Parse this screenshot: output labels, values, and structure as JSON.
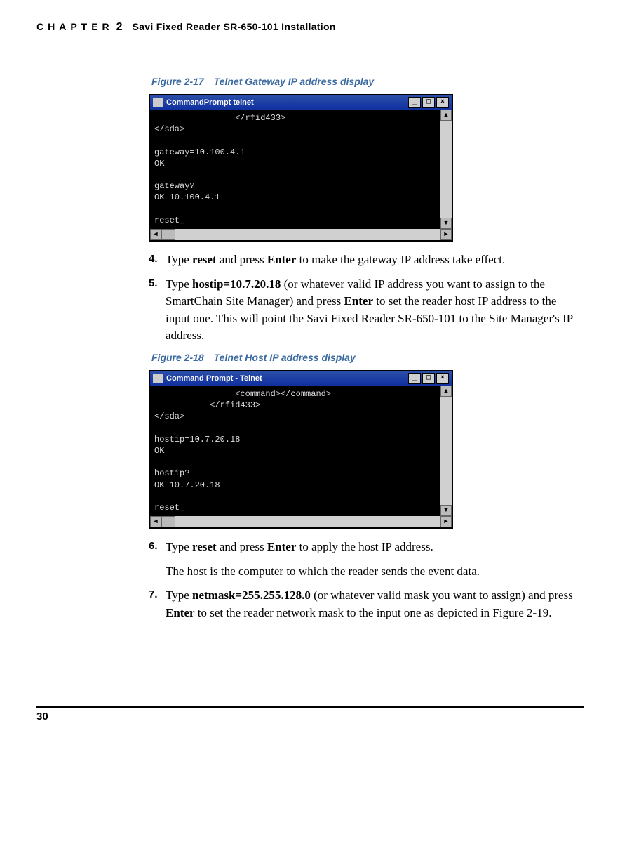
{
  "header": {
    "chapter_word": "CHAPTER",
    "chapter_num": "2",
    "title": "Savi Fixed Reader SR-650-101 Installation"
  },
  "fig17": {
    "label": "Figure 2-17",
    "caption": "Telnet Gateway IP address display",
    "titlebar_text": "CommandPrompt telnet",
    "body": "                </rfid433>\n</sda>\n\ngateway=10.100.4.1\nOK\n\ngateway?\nOK 10.100.4.1\n\nreset_"
  },
  "step4": {
    "num": "4.",
    "pre": "Type ",
    "cmd": "reset",
    "mid": " and press ",
    "key": "Enter",
    "post": " to make the gateway IP address take effect."
  },
  "step5": {
    "num": "5.",
    "pre": "Type ",
    "cmd": "hostip=10.7.20.18",
    "mid": " (or whatever valid IP address you want to assign to the SmartChain Site Manager) and press ",
    "key": "Enter",
    "post": " to set the reader host IP address to the input one. This will point the Savi Fixed Reader SR-650-101 to the Site Manager's IP address."
  },
  "fig18": {
    "label": "Figure 2-18",
    "caption": "Telnet Host IP address display",
    "titlebar_text": "Command Prompt - Telnet",
    "body": "                <command></command>\n           </rfid433>\n</sda>\n\nhostip=10.7.20.18\nOK\n\nhostip?\nOK 10.7.20.18\n\nreset_"
  },
  "step6": {
    "num": "6.",
    "pre": "Type ",
    "cmd": "reset",
    "mid": " and press ",
    "key": "Enter",
    "post": " to apply the host IP address."
  },
  "after6": "The host is the computer to which the reader sends the event data.",
  "step7": {
    "num": "7.",
    "pre": "Type ",
    "cmd": "netmask=255.255.128.0",
    "mid": " (or whatever valid mask you want to assign) and press ",
    "key": "Enter",
    "post": " to set the reader network mask to the input one as depicted in Figure 2-19."
  },
  "footer": {
    "page_num": "30"
  }
}
